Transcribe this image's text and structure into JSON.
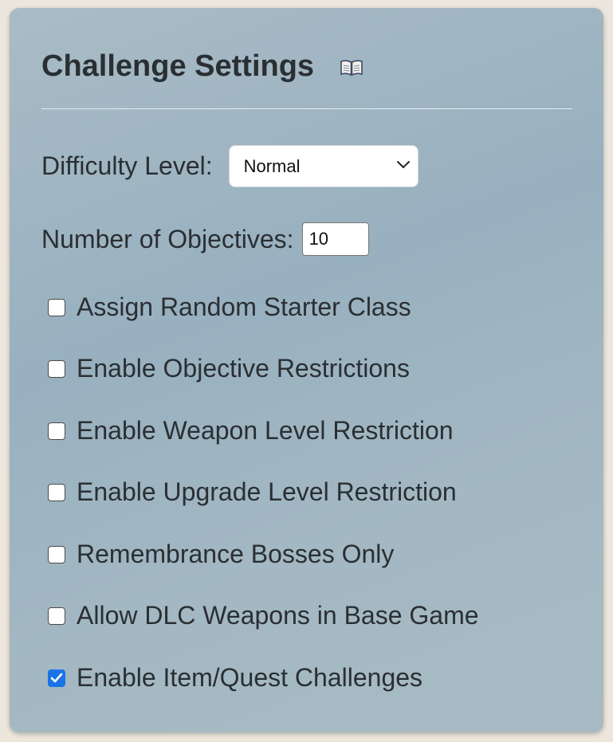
{
  "panel": {
    "title": "Challenge Settings",
    "title_icon": "book-icon"
  },
  "difficulty": {
    "label": "Difficulty Level:",
    "selected": "Normal"
  },
  "objectives": {
    "label": "Number of Objectives:",
    "value": "10"
  },
  "options": [
    {
      "label": "Assign Random Starter Class",
      "checked": false
    },
    {
      "label": "Enable Objective Restrictions",
      "checked": false
    },
    {
      "label": "Enable Weapon Level Restriction",
      "checked": false
    },
    {
      "label": "Enable Upgrade Level Restriction",
      "checked": false
    },
    {
      "label": "Remembrance Bosses Only",
      "checked": false
    },
    {
      "label": "Allow DLC Weapons in Base Game",
      "checked": false
    },
    {
      "label": "Enable Item/Quest Challenges",
      "checked": true
    }
  ],
  "colors": {
    "checkbox_checked": "#1a73e8",
    "text": "#2a2f33"
  }
}
